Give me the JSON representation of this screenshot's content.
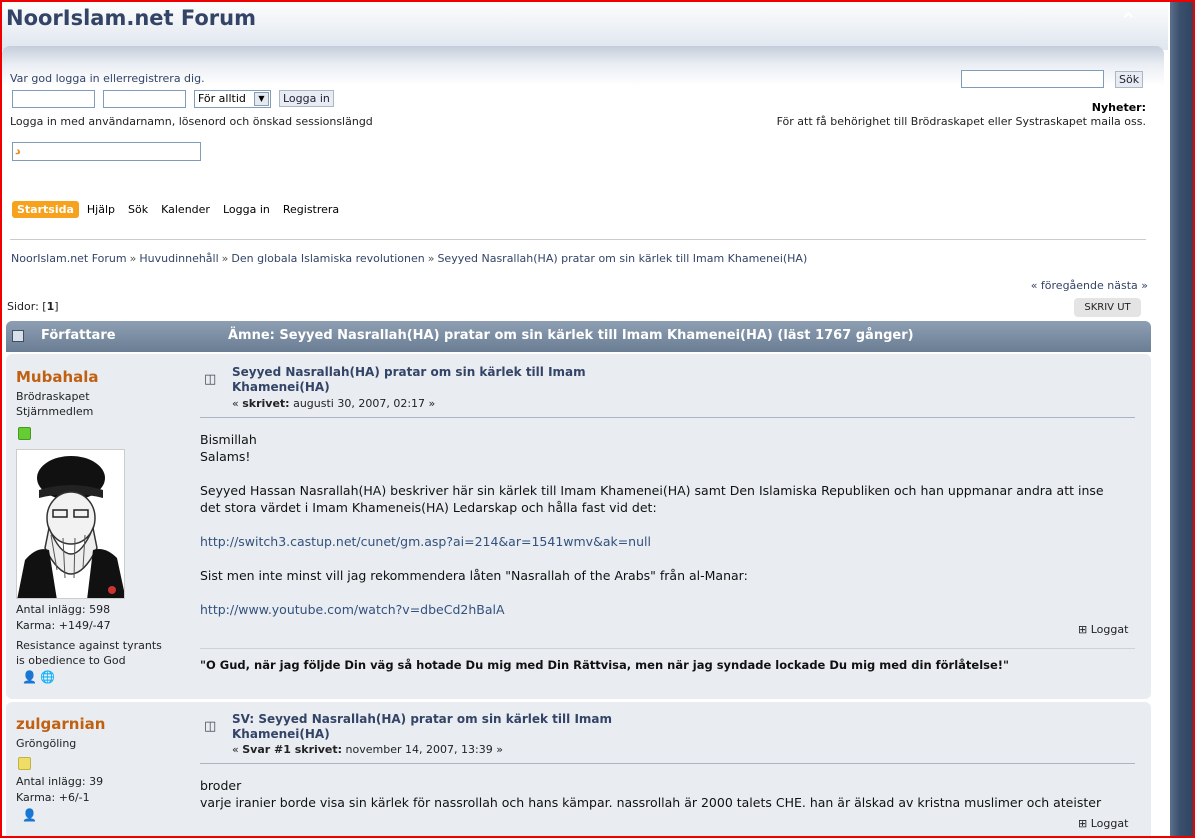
{
  "header": {
    "title": "NoorIslam.net Forum"
  },
  "user_section": {
    "greeting": "Var god logga in ellerregistrera dig.",
    "session_select": "För alltid",
    "login_button": "Logga in",
    "hint": "Logga in med användarnamn, lösenord och önskad sessionslängd",
    "search_button": "Sök",
    "news_label": "Nyheter:",
    "news_text": "För att få behörighet till Brödraskapet eller Systraskapet maila oss."
  },
  "menu": [
    "Startsida",
    "Hjälp",
    "Sök",
    "Kalender",
    "Logga in",
    "Registrera"
  ],
  "breadcrumb": [
    "NoorIslam.net Forum",
    "Huvudinnehåll",
    "Den globala Islamiska revolutionen",
    "Seyyed Nasrallah(HA) pratar om sin kärlek till Imam Khamenei(HA)"
  ],
  "nav": {
    "prevnext": "« föregående nästa »",
    "pages_label": "Sidor: [",
    "pages_current": "1",
    "pages_end": "]",
    "print": "SKRIV UT"
  },
  "category": {
    "author": "Författare",
    "topic": "Ämne: Seyyed Nasrallah(HA) pratar om sin kärlek till Imam Khamenei(HA)  (läst 1767 gånger)"
  },
  "posts": [
    {
      "name": "Mubahala",
      "group": "Brödraskapet",
      "rank": "Stjärnmedlem",
      "status_color": "#66cc33",
      "posts": "Antal inlägg: 598",
      "karma": "Karma: +149/-47",
      "quote1": "Resistance against tyrants",
      "quote2": "is obedience to God",
      "subject1": "Seyyed Nasrallah(HA) pratar om sin kärlek till Imam",
      "subject2": "Khamenei(HA)",
      "meta_prefix": "« ",
      "meta_bold": "skrivet:",
      "meta_date": " augusti 30, 2007, 02:17 »",
      "body": [
        "Bismillah",
        "Salams!",
        "",
        "Seyyed Hassan Nasrallah(HA) beskriver här sin kärlek till Imam Khamenei(HA) samt Den Islamiska Republiken och han uppmanar andra att inse",
        "det stora värdet i Imam Khameneis(HA) Ledarskap och hålla fast vid det:"
      ],
      "link1": "http://switch3.castup.net/cunet/gm.asp?ai=214&ar=1541wmv&ak=null",
      "text2": "Sist men inte minst vill jag rekommendera låten \"Nasrallah of the Arabs\" från al-Manar:",
      "link2": "http://www.youtube.com/watch?v=dbeCd2hBalA",
      "logged": "Loggat",
      "signature": "\"O Gud, när jag följde Din väg så hotade Du mig med Din Rättvisa, men när jag syndade lockade Du mig med din förlåtelse!\""
    },
    {
      "name": "zulgarnian",
      "group": "Gröngöling",
      "status_color": "#eedd66",
      "posts": "Antal inlägg: 39",
      "karma": "Karma: +6/-1",
      "subject1": "SV: Seyyed Nasrallah(HA) pratar om sin kärlek till Imam",
      "subject2": "Khamenei(HA)",
      "meta_prefix": "« ",
      "meta_bold": "Svar #1 skrivet:",
      "meta_date": " november 14, 2007, 13:39 »",
      "body1": "broder",
      "body2": "varje iranier borde visa sin kärlek för nassrollah och hans kämpar. nassrollah är 2000 talets CHE. han är älskad av kristna muslimer och ateister",
      "logged": "Loggat"
    }
  ]
}
